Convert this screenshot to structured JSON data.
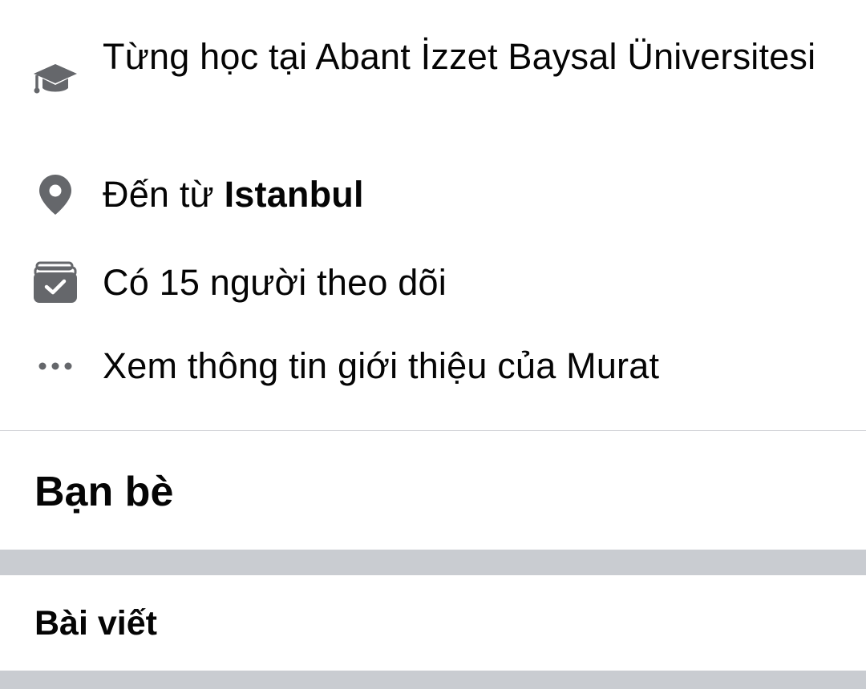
{
  "intro": {
    "education": "Từng học tại Abant İzzet Baysal Üniversitesi",
    "hometown_prefix": "Đến từ ",
    "hometown_place": "Istanbul",
    "followers": "Có 15 người theo dõi",
    "see_about": "Xem thông tin giới thiệu của Murat"
  },
  "icons": {
    "education": "graduation-cap-icon",
    "hometown": "location-pin-icon",
    "followers": "followers-rss-icon",
    "see_about": "more-dots-icon"
  },
  "sections": {
    "friends_title": "Bạn bè",
    "posts_title": "Bài viết"
  },
  "colors": {
    "text": "#050505",
    "icon": "#65676b",
    "divider": "#ced0d4",
    "band": "#c9ccd1"
  }
}
